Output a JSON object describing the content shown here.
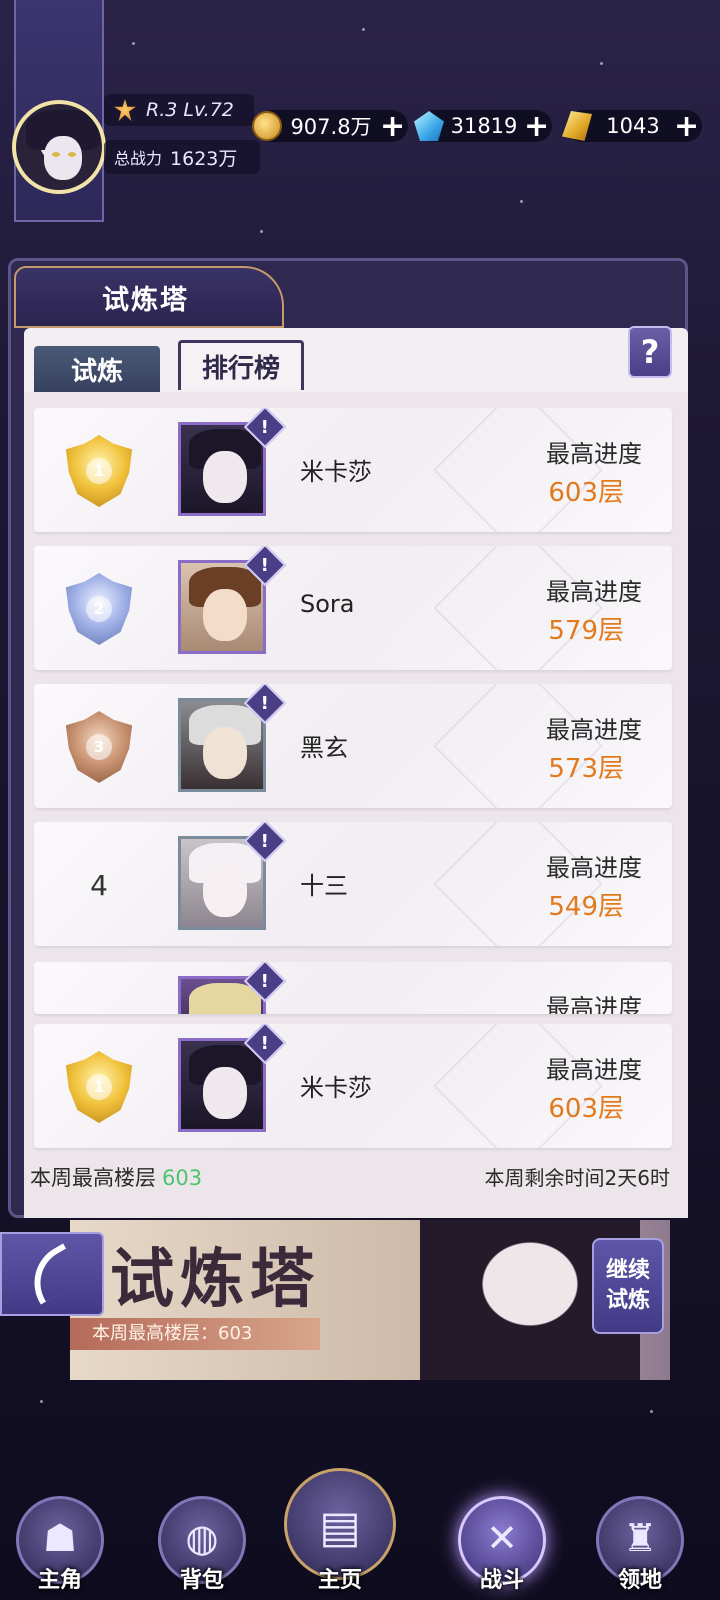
{
  "header": {
    "rank_level": "R.3 Lv.72",
    "power_label": "总战力",
    "power_value": "1623万"
  },
  "currencies": [
    {
      "icon": "gold-coin-icon",
      "value": "907.8万"
    },
    {
      "icon": "blue-gem-icon",
      "value": "31819"
    },
    {
      "icon": "gold-crystal-icon",
      "value": "1043"
    }
  ],
  "panel": {
    "title": "试炼塔",
    "tabs": [
      "试炼",
      "排行榜"
    ],
    "active_tab": "排行榜",
    "help": "?"
  },
  "rankings": [
    {
      "rank": "1",
      "medal": "gold",
      "name": "米卡莎",
      "progress_label": "最高进度",
      "progress_value": "603层"
    },
    {
      "rank": "2",
      "medal": "silver",
      "name": "Sora",
      "progress_label": "最高进度",
      "progress_value": "579层"
    },
    {
      "rank": "3",
      "medal": "bronze",
      "name": "黑玄",
      "progress_label": "最高进度",
      "progress_value": "573层"
    },
    {
      "rank": "4",
      "medal": "",
      "name": "十三",
      "progress_label": "最高进度",
      "progress_value": "549层"
    }
  ],
  "partial_row": {
    "progress_label": "最高进度"
  },
  "my_ranking": {
    "rank": "1",
    "medal": "gold",
    "name": "米卡莎",
    "progress_label": "最高进度",
    "progress_value": "603层"
  },
  "footer": {
    "weekly_best_label": "本周最高楼层",
    "weekly_best_value": "603",
    "remaining": "本周剩余时间2天6时"
  },
  "background_banner": {
    "title": "试炼塔",
    "floor_text": "本周最高楼层：603"
  },
  "continue_button": [
    "继续",
    "试炼"
  ],
  "bottom_nav": [
    {
      "label": "主角",
      "icon": "hero-icon"
    },
    {
      "label": "背包",
      "icon": "bag-icon"
    },
    {
      "label": "主页",
      "icon": "home-book-icon"
    },
    {
      "label": "战斗",
      "icon": "crossed-swords-icon"
    },
    {
      "label": "领地",
      "icon": "castle-icon"
    }
  ]
}
